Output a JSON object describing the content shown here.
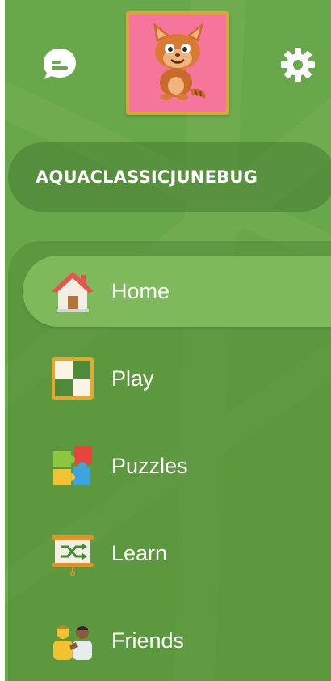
{
  "profile": {
    "username": "AQUACLASSICJUNEBUG",
    "avatar_icon": "cat-avatar"
  },
  "toolbar": {
    "chat_icon": "chat-bubble-icon",
    "settings_icon": "gear-icon"
  },
  "nav": {
    "items": [
      {
        "label": "Home",
        "icon": "home-icon",
        "active": true
      },
      {
        "label": "Play",
        "icon": "chessboard-icon",
        "active": false
      },
      {
        "label": "Puzzles",
        "icon": "puzzle-icon",
        "active": false
      },
      {
        "label": "Learn",
        "icon": "learn-board-icon",
        "active": false
      },
      {
        "label": "Friends",
        "icon": "friends-icon",
        "active": false
      }
    ]
  },
  "colors": {
    "background": "#69a84a",
    "active_item": "#7eb95c",
    "avatar_bg": "#f6769b",
    "avatar_border": "#d6a637"
  }
}
